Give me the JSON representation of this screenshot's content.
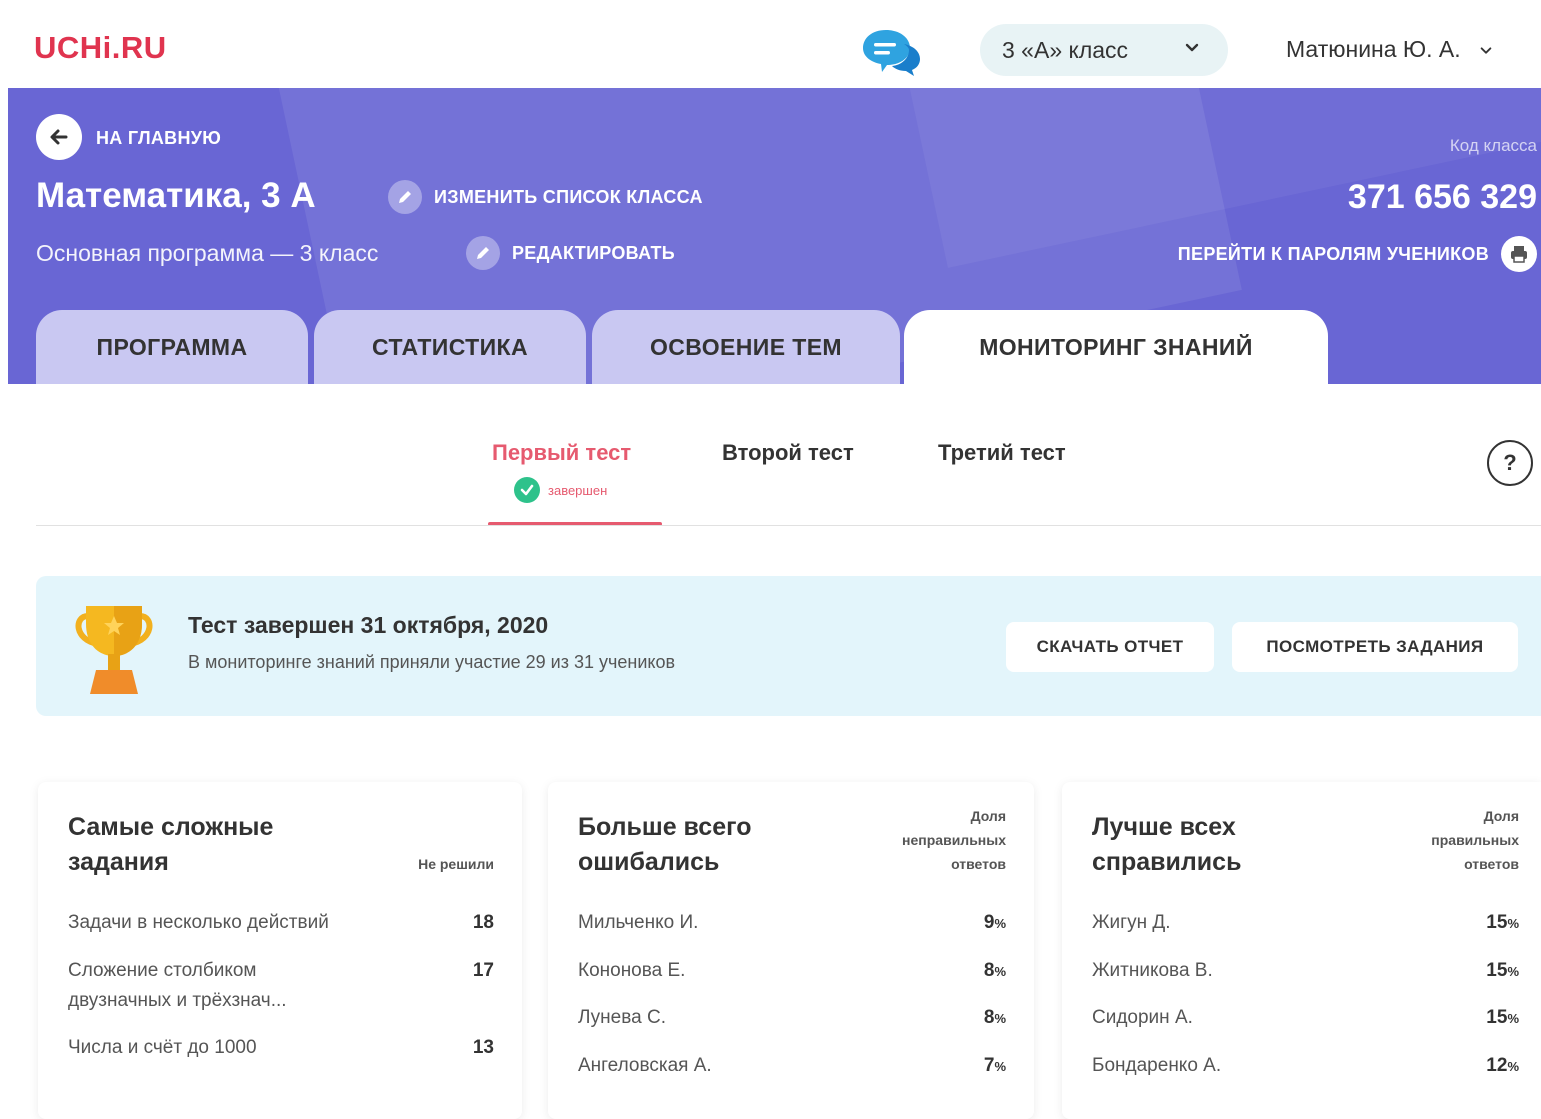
{
  "topbar": {
    "logo": "UCHi.RU",
    "class_select": "3 «А» класс",
    "user": "Матюнина Ю. А."
  },
  "header": {
    "back_label": "НА ГЛАВНУЮ",
    "course_title": "Математика, 3 А",
    "edit_list_label": "ИЗМЕНИТЬ СПИСОК КЛАССА",
    "program_subtitle": "Основная программа — 3 класс",
    "edit_program_label": "РЕДАКТИРОВАТЬ",
    "class_code_label": "Код класса",
    "class_code": "371 656 329",
    "passwords_label": "ПЕРЕЙТИ К ПАРОЛЯМ УЧЕНИКОВ"
  },
  "tabs": [
    {
      "label": "ПРОГРАММА"
    },
    {
      "label": "СТАТИСТИКА"
    },
    {
      "label": "ОСВОЕНИЕ ТЕМ"
    },
    {
      "label": "МОНИТОРИНГ ЗНАНИЙ",
      "active": true
    }
  ],
  "subtabs": [
    {
      "label": "Первый тест",
      "status": "завершен",
      "active": true
    },
    {
      "label": "Второй тест"
    },
    {
      "label": "Третий тест"
    }
  ],
  "help_label": "?",
  "banner": {
    "title": "Тест завершен 31 октября, 2020",
    "subtitle": "В мониторинге знаний приняли участие 29 из 31 учеников",
    "download_label": "СКАЧАТЬ ОТЧЕТ",
    "view_label": "ПОСМОТРЕТЬ ЗАДАНИЯ"
  },
  "cards": [
    {
      "title_line1": "Самые сложные",
      "title_line2": "задания",
      "col_head": "Не решили",
      "rows": [
        {
          "name": "Задачи в несколько действий",
          "value": "18"
        },
        {
          "name": "Сложение столбиком двузначных и трёхзнач...",
          "value": "17"
        },
        {
          "name": "Числа и счёт до 1000",
          "value": "13"
        }
      ]
    },
    {
      "title_line1": "Больше всего",
      "title_line2": "ошибались",
      "col_head_1": "Доля",
      "col_head_2": "неправильных",
      "col_head_3": "ответов",
      "rows": [
        {
          "name": "Мильченко И.",
          "value": "9",
          "unit": "%"
        },
        {
          "name": "Кононова Е.",
          "value": "8",
          "unit": "%"
        },
        {
          "name": "Лунева С.",
          "value": "8",
          "unit": "%"
        },
        {
          "name": "Ангеловская А.",
          "value": "7",
          "unit": "%"
        }
      ]
    },
    {
      "title_line1": "Лучше всех",
      "title_line2": "справились",
      "col_head_1": "Доля",
      "col_head_2": "правильных",
      "col_head_3": "ответов",
      "rows": [
        {
          "name": "Жигун Д.",
          "value": "15",
          "unit": "%"
        },
        {
          "name": "Житникова В.",
          "value": "15",
          "unit": "%"
        },
        {
          "name": "Сидорин А.",
          "value": "15",
          "unit": "%"
        },
        {
          "name": "Бондаренко А.",
          "value": "12",
          "unit": "%"
        }
      ]
    }
  ],
  "colors": {
    "brand": "#e0344f",
    "header": "#6966d4",
    "tab_inactive": "#c9c8f2",
    "accent": "#e65a6f",
    "success": "#2ec28b",
    "banner": "#e3f5fb"
  },
  "icons": [
    "chat-icon",
    "chevron-down-icon",
    "arrow-left-icon",
    "pencil-icon",
    "printer-icon",
    "check-icon",
    "help-icon",
    "trophy-icon"
  ]
}
